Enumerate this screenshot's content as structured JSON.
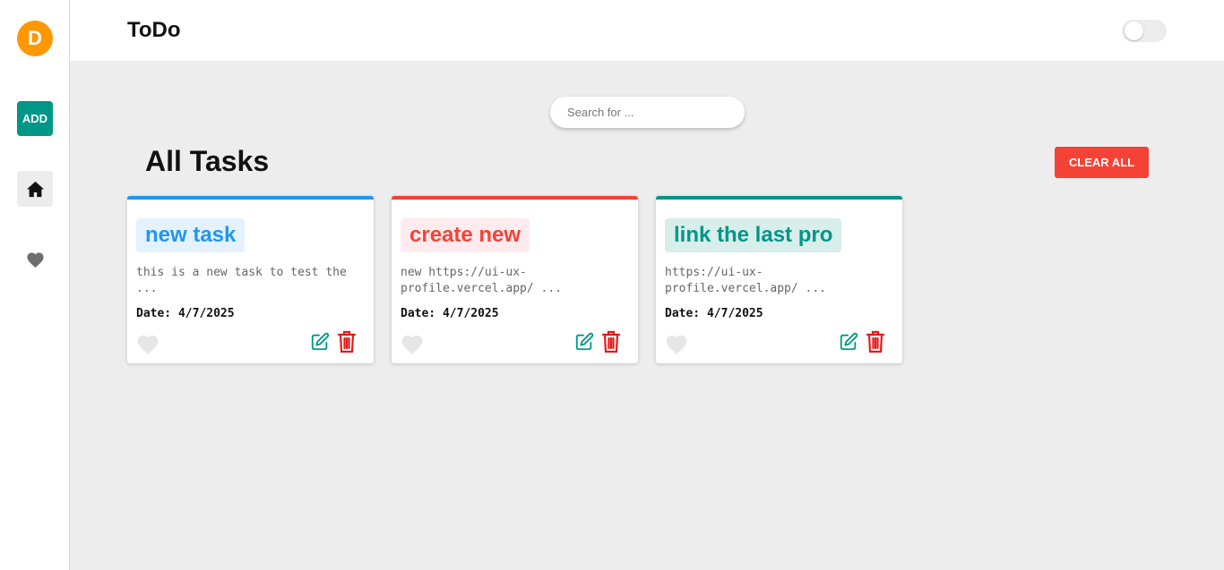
{
  "sidebar": {
    "avatar_letter": "D",
    "add_label": "ADD"
  },
  "header": {
    "title": "ToDo"
  },
  "search": {
    "placeholder": "Search for ..."
  },
  "main": {
    "title": "All Tasks",
    "clear_label": "CLEAR ALL"
  },
  "colors": {
    "accent_teal": "#009688",
    "avatar": "#ff9800",
    "danger": "#f44336"
  },
  "tasks": [
    {
      "title": "new task",
      "description": "this is a new task to test the ...",
      "date": "Date: 4/7/2025",
      "accent": "#2196f3",
      "title_bg": "#e3f2fd"
    },
    {
      "title": "create new",
      "description": "new https://ui-ux-profile.vercel.app/ ...",
      "date": "Date: 4/7/2025",
      "accent": "#f44336",
      "title_bg": "#ffebee"
    },
    {
      "title": "link the last pro",
      "description": "https://ui-ux-profile.vercel.app/ ...",
      "date": "Date: 4/7/2025",
      "accent": "#009688",
      "title_bg": "#d7eeeb"
    }
  ]
}
